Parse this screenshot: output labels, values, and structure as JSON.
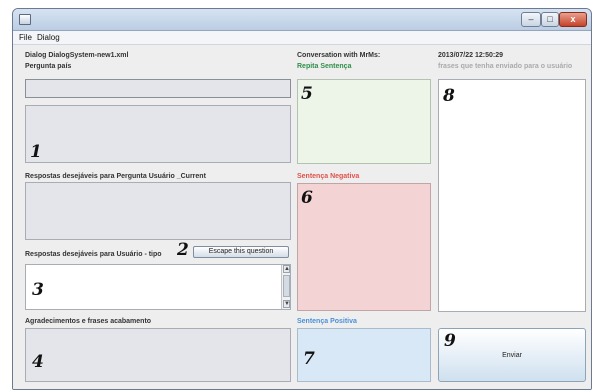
{
  "window": {
    "title": "",
    "controls": {
      "minimize": "–",
      "maximize": "□",
      "close": "x"
    }
  },
  "menu": {
    "items": [
      "File",
      "Dialog"
    ]
  },
  "left": {
    "dialog_file": "Dialog DialogSystem-new1.xml",
    "country_question_label": "Pergunta país",
    "desired_answers_current_label": "Respostas desejáveis para Pergunta Usuário _Current",
    "desired_answers_type_label": "Respostas desejáveis para Usuário - tipo",
    "escape_button": "Escape this question",
    "closing_label": "Agradecimentos e frases acabamento"
  },
  "middle": {
    "conversation_label": "Conversation with MrMs:",
    "repeat_label": "Repita Sentença",
    "negative_label": "Sentença Negativa",
    "positive_label": "Sentença Positiva"
  },
  "right": {
    "timestamp": "2013/07/22 12:50:29",
    "sent_phrases_label": "frases que tenha enviado para o usuário",
    "send_button": "Enviar"
  },
  "markers": [
    "1",
    "2",
    "3",
    "4",
    "5",
    "6",
    "7",
    "8",
    "9"
  ],
  "colors": {
    "accent_green": "#2f8f4a",
    "accent_red": "#e0514a",
    "accent_blue": "#4a90d9",
    "negative_panel": "#f3d3d3",
    "repeat_panel": "#ecf5e8",
    "positive_panel": "#d8e8f6"
  }
}
